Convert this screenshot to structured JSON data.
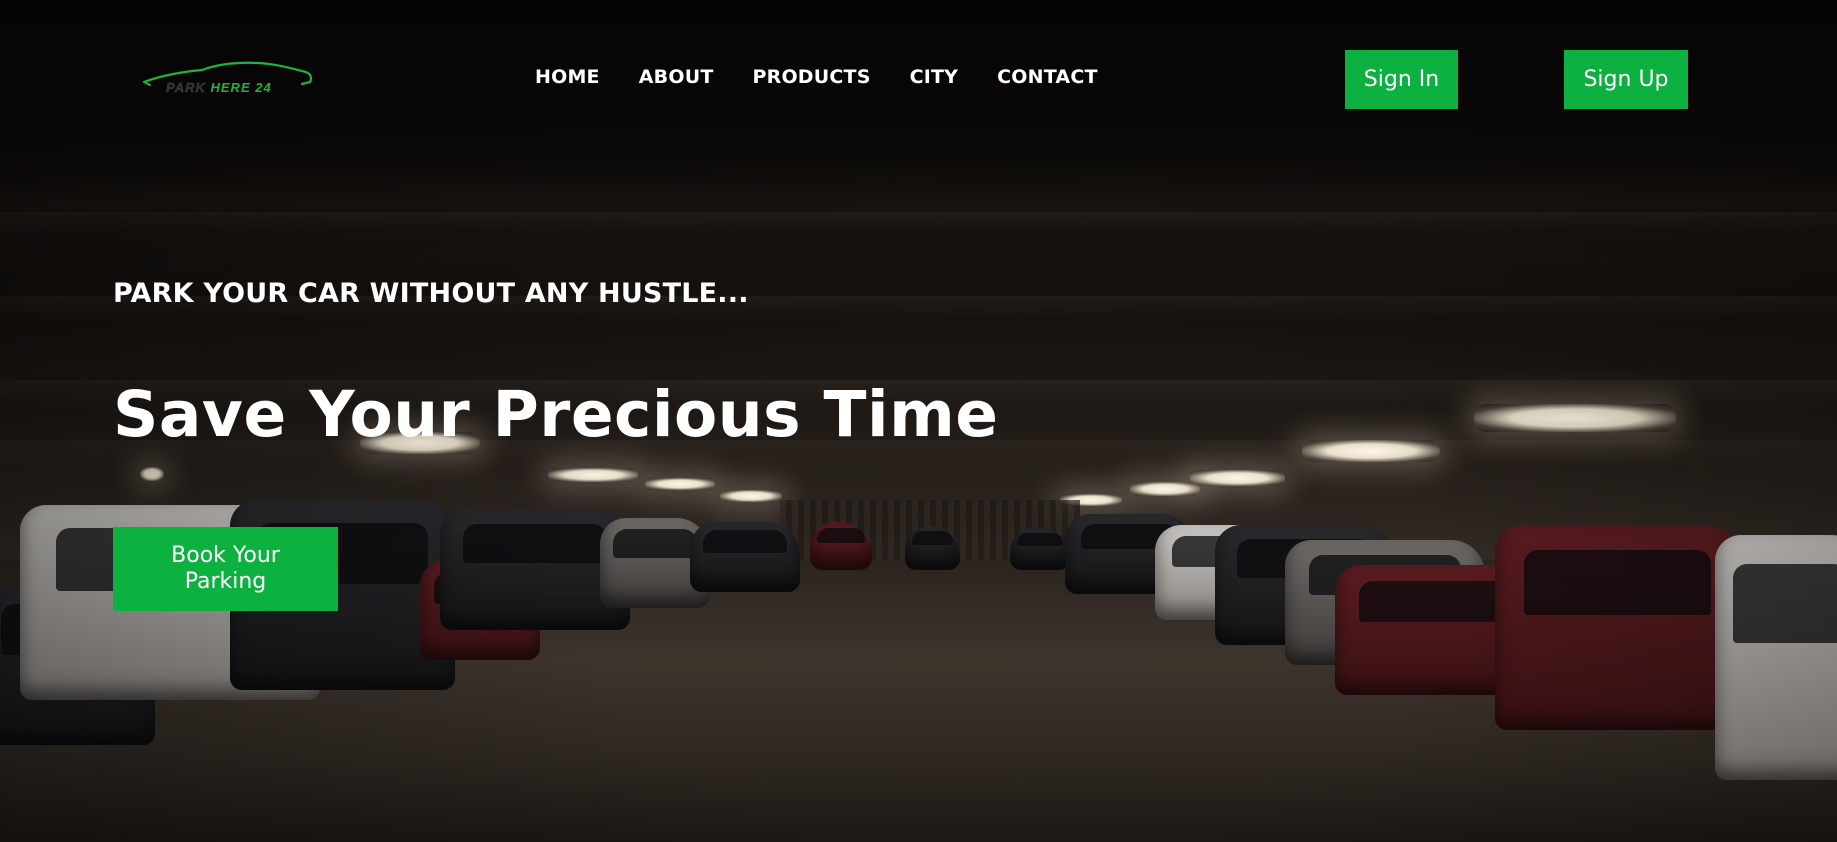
{
  "brand": {
    "logo_text_dim": "PARK",
    "logo_text_accent": "HERE 24",
    "accent_color": "#0cb13f"
  },
  "nav": {
    "links": [
      "HOME",
      "ABOUT",
      "PRODUCTS",
      "CITY",
      "CONTACT"
    ]
  },
  "auth": {
    "sign_in_label": "Sign In",
    "sign_up_label": "Sign Up"
  },
  "hero": {
    "tagline": "PARK YOUR CAR WITHOUT ANY HUSTLE...",
    "headline": "Save Your Precious Time",
    "cta_label": "Book Your Parking",
    "background": "parking-garage-photo"
  }
}
